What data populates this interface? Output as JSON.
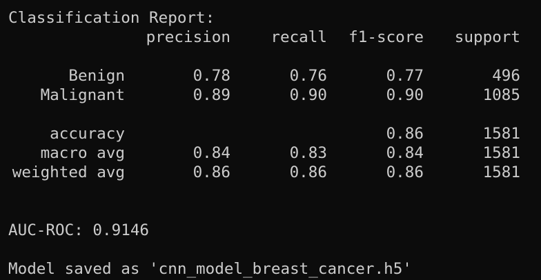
{
  "report": {
    "title": "Classification Report:",
    "headers": {
      "precision": "precision",
      "recall": "recall",
      "f1": "f1-score",
      "support": "support"
    },
    "rows": [
      {
        "label": "Benign",
        "precision": "0.78",
        "recall": "0.76",
        "f1": "0.77",
        "support": "496"
      },
      {
        "label": "Malignant",
        "precision": "0.89",
        "recall": "0.90",
        "f1": "0.90",
        "support": "1085"
      },
      {
        "label": "accuracy",
        "precision": "",
        "recall": "",
        "f1": "0.86",
        "support": "1581"
      },
      {
        "label": "macro avg",
        "precision": "0.84",
        "recall": "0.83",
        "f1": "0.84",
        "support": "1581"
      },
      {
        "label": "weighted avg",
        "precision": "0.86",
        "recall": "0.86",
        "f1": "0.86",
        "support": "1581"
      }
    ]
  },
  "auc_line": "AUC-ROC: 0.9146",
  "saved_line": "Model saved as 'cnn_model_breast_cancer.h5'",
  "colors": {
    "background": "#0c0c0c",
    "text": "#cccccc"
  }
}
